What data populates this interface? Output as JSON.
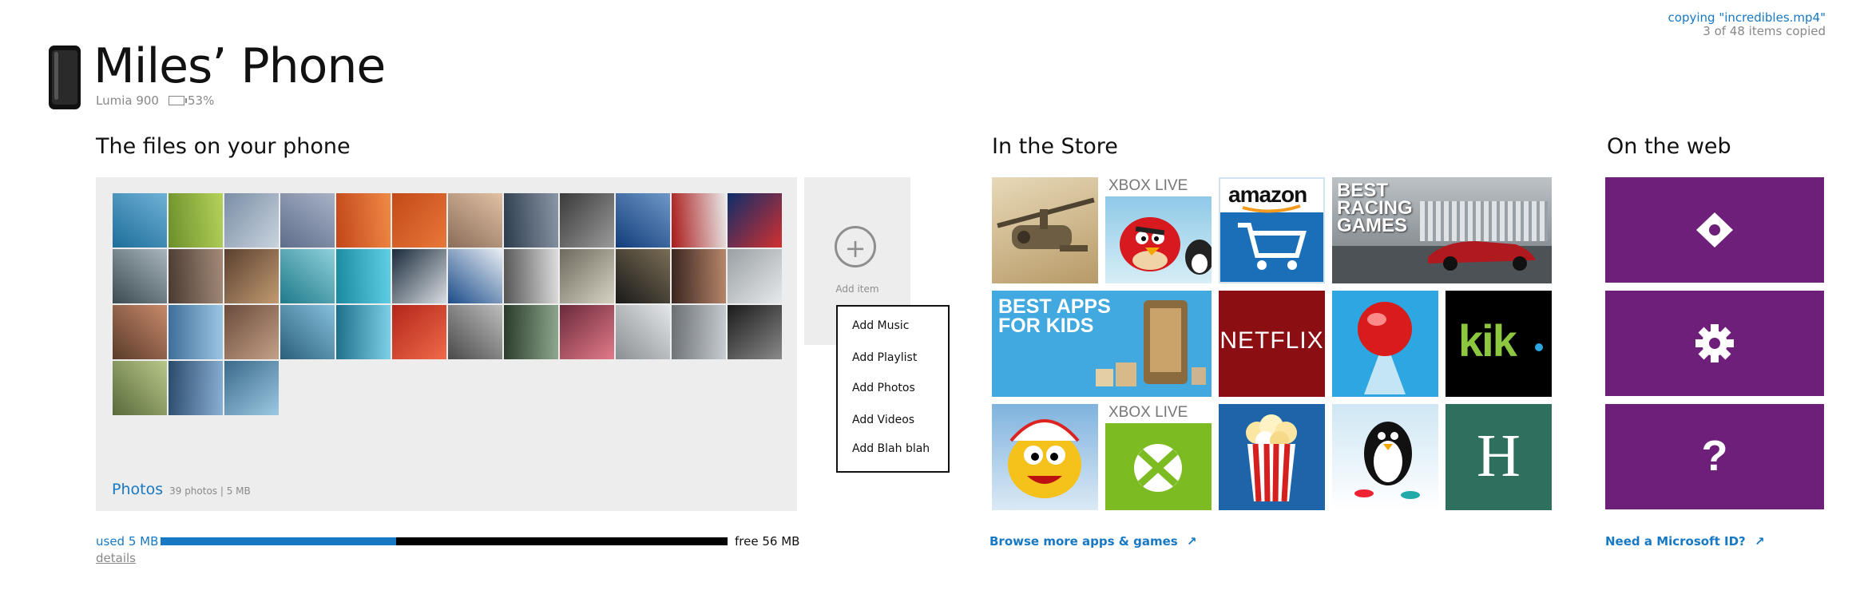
{
  "header": {
    "title": "Miles’ Phone",
    "model": "Lumia 900",
    "battery": "53%"
  },
  "copy_status": {
    "line1": "copying \"incredibles.mp4\"",
    "line2": "3 of 48 items copied"
  },
  "files": {
    "heading": "The files on your phone",
    "photos_label": "Photos",
    "photos_meta": "39 photos | 5 MB",
    "photo_count": 39,
    "add_item_label": "Add item",
    "add_menu": [
      "Add Music",
      "Add Playlist",
      "Add Photos",
      "Add Videos",
      "Add Blah blah"
    ]
  },
  "storage": {
    "used_label": "used 5 MB",
    "free_label": "free 56 MB",
    "used_fraction": 0.415,
    "details_label": "details"
  },
  "store": {
    "heading": "In the Store",
    "tiles": {
      "xbox_live_1": "XBOX LIVE",
      "amazon": "amazon",
      "best_racing": "BEST RACING GAMES",
      "best_apps": "BEST APPS FOR KIDS",
      "netflix": "NETFLIX",
      "kik": "kik",
      "xbox_live_2": "XBOX LIVE",
      "h_letter": "H"
    },
    "browse_label": "Browse more apps & games"
  },
  "web": {
    "heading": "On the web",
    "icons": [
      "diamond-icon",
      "gear-icon",
      "question-icon"
    ],
    "tile_color": "#6d1f7a",
    "microsoft_id_label": "Need a Microsoft ID?"
  },
  "colors": {
    "accent": "#1778c4",
    "panel": "#ededed",
    "purple": "#6d1f7a"
  }
}
